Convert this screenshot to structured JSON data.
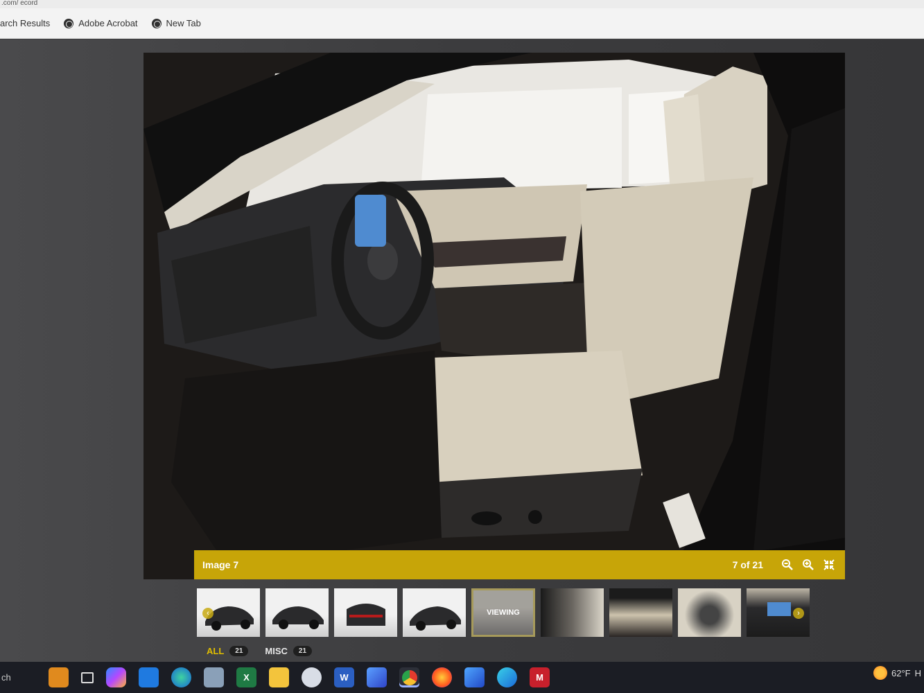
{
  "browser": {
    "url_fragment": ".com/ ecord",
    "bookmarks": [
      {
        "label": "arch Results",
        "icon": "none"
      },
      {
        "label": "Adobe Acrobat",
        "icon": "globe-icon"
      },
      {
        "label": "New Tab",
        "icon": "globe-icon"
      }
    ]
  },
  "viewer": {
    "caption": "Image 7",
    "counter": "7 of 21",
    "controls": [
      "zoom-out-icon",
      "zoom-in-icon",
      "collapse-icon"
    ]
  },
  "thumbnails": {
    "items": [
      {
        "subject": "exterior front three-quarter"
      },
      {
        "subject": "exterior side"
      },
      {
        "subject": "exterior rear"
      },
      {
        "subject": "exterior rear three-quarter"
      },
      {
        "subject": "interior front seats",
        "active": true,
        "label": "VIEWING"
      },
      {
        "subject": "interior driver door"
      },
      {
        "subject": "interior door panel"
      },
      {
        "subject": "steering wheel"
      },
      {
        "subject": "dashboard screen"
      }
    ],
    "prev_icon": "chevron-left-icon",
    "next_icon": "chevron-right-icon"
  },
  "filters": [
    {
      "label": "ALL",
      "count": "21"
    },
    {
      "label": "MISC",
      "count": "21"
    }
  ],
  "taskbar": {
    "search_fragment": "ch",
    "apps": [
      "briefcase-icon",
      "task-view-icon",
      "copilot-icon",
      "mail-icon",
      "edge-icon",
      "computer-icon",
      "excel-icon",
      "file-explorer-icon",
      "paint-icon",
      "word-icon",
      "app-icon",
      "chrome-icon",
      "firefox-icon",
      "app2-icon",
      "app3-icon",
      "mcafee-icon"
    ],
    "weather": "62°F",
    "weather_trailing": "H"
  },
  "colors": {
    "accent": "#c7a508",
    "page_bg": "#3f3f41",
    "taskbar": "#1b1d24"
  }
}
